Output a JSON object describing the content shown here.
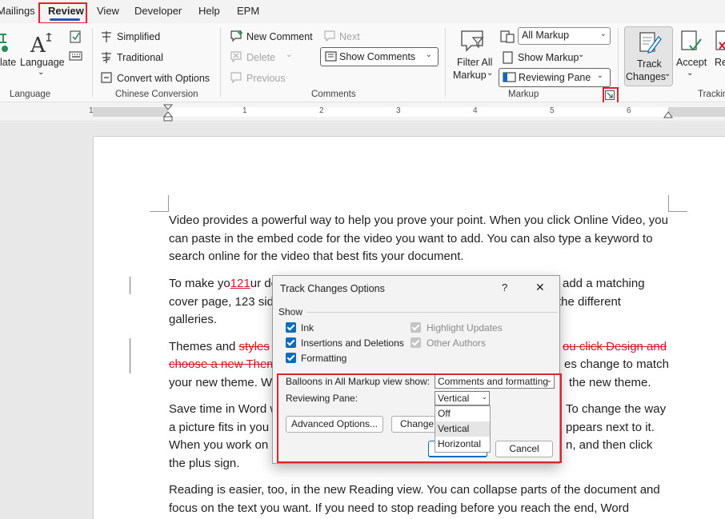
{
  "menubar": {
    "tabs": [
      {
        "label": "Mailings"
      },
      {
        "label": "Review"
      },
      {
        "label": "View"
      },
      {
        "label": "Developer"
      },
      {
        "label": "Help"
      },
      {
        "label": "EPM"
      }
    ],
    "active_tab": "Review"
  },
  "ribbon": {
    "language_group": {
      "translate_label": "late",
      "language_label": "Language",
      "group_label": "Language"
    },
    "chinese_group": {
      "simplified": "Simplified",
      "traditional": "Traditional",
      "convert": "Convert with Options",
      "group_label": "Chinese Conversion"
    },
    "comments_group": {
      "new_comment": "New Comment",
      "next": "Next",
      "delete": "Delete",
      "previous": "Previous",
      "show_comments": "Show Comments",
      "group_label": "Comments"
    },
    "markup_group": {
      "filter_all_markup": "Filter All",
      "filter_all_markup_2": "Markup",
      "all_markup": "All Markup",
      "show_markup": "Show Markup",
      "reviewing_pane": "Reviewing Pane",
      "group_label": "Markup"
    },
    "tracking_group": {
      "track_changes_1": "Track",
      "track_changes_2": "Changes",
      "accept": "Accept",
      "reject": "Re",
      "group_label": "Trackin"
    }
  },
  "ruler": {
    "numbers": [
      "1",
      "1",
      "2",
      "3",
      "4",
      "5",
      "6"
    ]
  },
  "document": {
    "p1": "Video provides a powerful way to help you prove your point. When you click Online Video, you can paste in the embed code for the video you want to add. You can also type a keyword to search online for the video that best fits your document.",
    "p2_line1_a": "To make yo",
    "p2_line1_ins": "121",
    "p2_line1_b": "ur do",
    "p2_line1_c": "add a matching",
    "p2_line2_a": "cover page, 123 sid",
    "p2_line2_b": "the different",
    "p2_line3": "galleries.",
    "p3_line1_a": "Themes and ",
    "p3_line1_del": "styles",
    "p3_line1_del2": "ou click Design and",
    "p3_line2_del": "choose a new Them",
    "p3_line2_b": "es change to match",
    "p3_line3_a": "your new theme. W",
    "p3_line3_b": "the new theme.",
    "p4_line1_a": "Save time in Word w",
    "p4_line1_b": "To change the way",
    "p4_line2_a": "a picture fits in you",
    "p4_line2_b": "ppears next to it.",
    "p4_line3_a": "When you work on",
    "p4_line3_b": "n, and then click",
    "p4_line4": "the plus sign.",
    "p5": "Reading is easier, too, in the new Reading view. You can collapse parts of the document and focus on the text you want. If you need to stop reading before you reach the end, Word"
  },
  "dialog": {
    "title": "Track Changes Options",
    "help": "?",
    "close": "✕",
    "show_label": "Show",
    "ink": "Ink",
    "insertions": "Insertions and Deletions",
    "formatting": "Formatting",
    "highlight": "Highlight Updates",
    "other_authors": "Other Authors",
    "balloons_label": "Balloons in All Markup view show:",
    "balloons_value": "Comments and formatting",
    "pane_label": "Reviewing Pane:",
    "pane_value": "Vertical",
    "pane_options": [
      "Off",
      "Vertical",
      "Horizontal"
    ],
    "advanced": "Advanced Options...",
    "change": "Change",
    "cancel": "Cancel"
  },
  "colors": {
    "highlight_red": "#e0232e",
    "accent_blue": "#0f6cbd",
    "revision_red": "#d4182c"
  }
}
